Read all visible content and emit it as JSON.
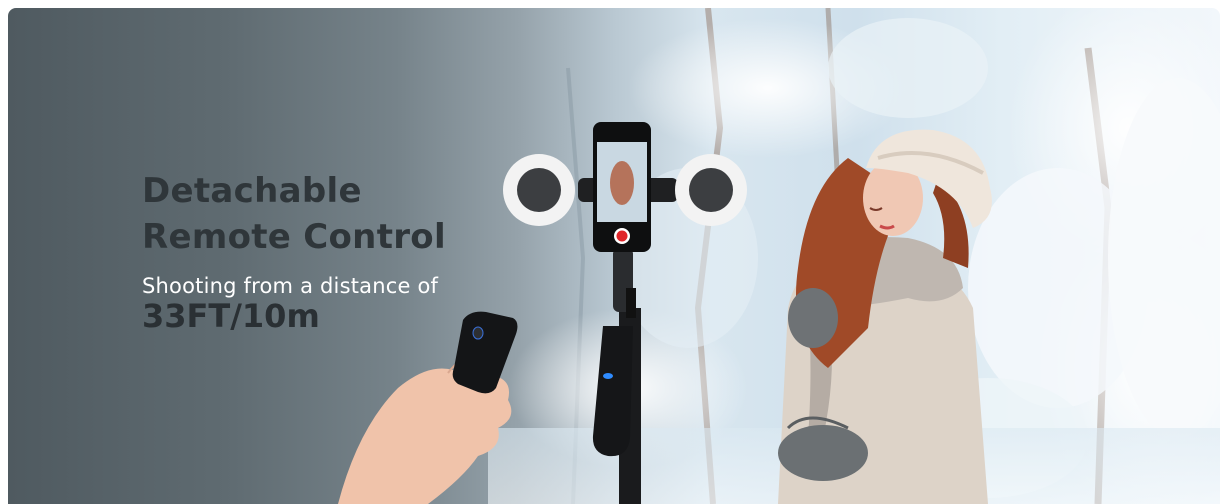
{
  "banner": {
    "headline_line1": "Detachable",
    "headline_line2": "Remote Control",
    "subline": "Shooting from a distance of",
    "distance": "33FT/10m",
    "ring_light_logo": "",
    "colors": {
      "headline": "#2f363a",
      "subline": "#ffffff",
      "record_button": "#e0262a"
    }
  }
}
